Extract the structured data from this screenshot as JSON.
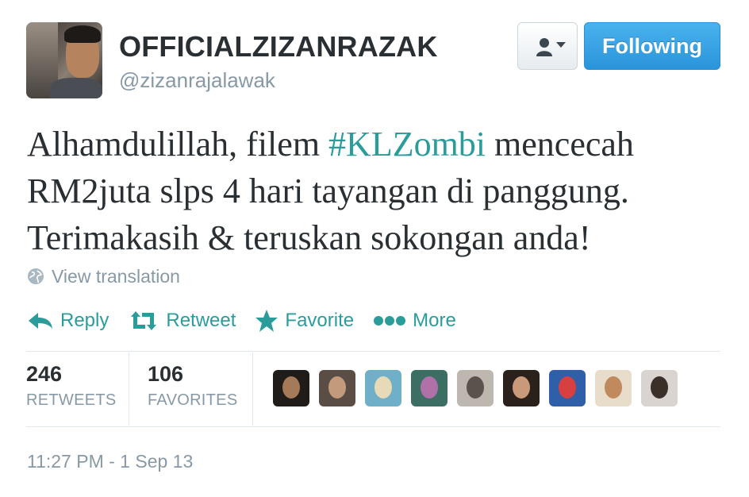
{
  "author": {
    "display_name": "OFFICIALZIZANRAZAK",
    "handle": "@zizanrajalawak"
  },
  "header": {
    "follow_button_label": "Following"
  },
  "tweet": {
    "text_before": "Alhamdulillah, filem ",
    "hashtag": "#KLZombi",
    "text_after": " mencecah RM2juta slps 4 hari tayangan di panggung. Terimakasih & teruskan sokongan anda!",
    "view_translation_label": "View translation",
    "timestamp": "11:27 PM - 1 Sep 13"
  },
  "actions": {
    "reply_label": "Reply",
    "retweet_label": "Retweet",
    "favorite_label": "Favorite",
    "more_label": "More"
  },
  "stats": {
    "retweets_count": "246",
    "retweets_label": "RETWEETS",
    "favorites_count": "106",
    "favorites_label": "FAVORITES"
  },
  "colors": {
    "accent": "#2a9d9b",
    "follow_button": "#2a94db",
    "muted_text": "#8899a6"
  },
  "icons": [
    "user-dropdown-icon",
    "globe-icon",
    "reply-icon",
    "retweet-icon",
    "star-icon",
    "more-dots-icon"
  ]
}
